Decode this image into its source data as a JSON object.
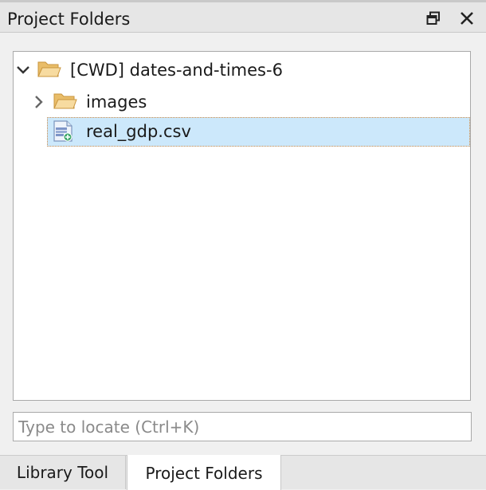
{
  "panel": {
    "title": "Project Folders",
    "restore_icon": "restore-window-icon",
    "close_icon": "close-icon"
  },
  "tree": {
    "root": {
      "label": "[CWD] dates-and-times-6",
      "expanded": true,
      "icon": "folder-open-icon"
    },
    "children": [
      {
        "label": "images",
        "expanded": false,
        "icon": "folder-open-icon"
      },
      {
        "label": "real_gdp.csv",
        "selected": true,
        "icon": "csv-file-icon"
      }
    ]
  },
  "search": {
    "placeholder": "Type to locate (Ctrl+K)",
    "value": ""
  },
  "tabs": [
    {
      "label": "Library Tool",
      "active": false
    },
    {
      "label": "Project Folders",
      "active": true
    }
  ],
  "colors": {
    "selection": "#cce8fb",
    "selection_border": "#d28d47",
    "folder": "#f0cf8a"
  }
}
